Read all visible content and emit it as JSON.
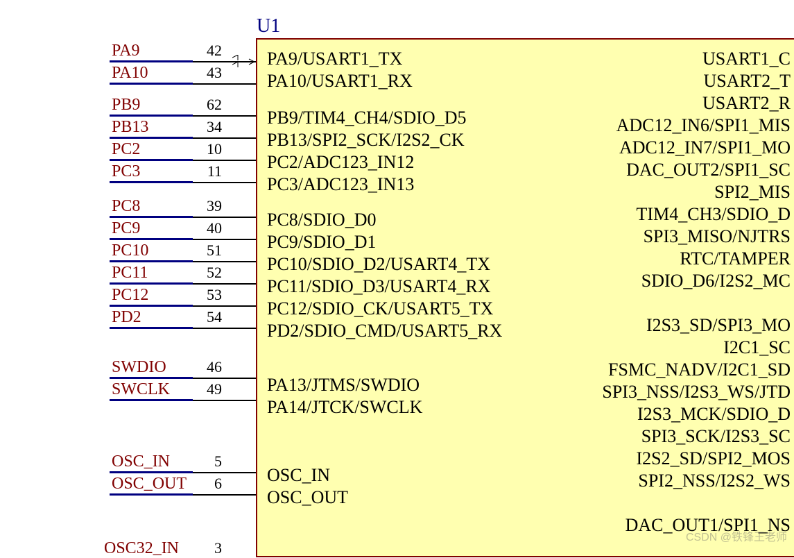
{
  "designator": "U1",
  "left_pins": [
    {
      "net": "PA9",
      "num": "42",
      "func": "PA9/USART1_TX"
    },
    {
      "net": "PA10",
      "num": "43",
      "func": "PA10/USART1_RX"
    },
    null,
    {
      "net": "PB9",
      "num": "62",
      "func": "PB9/TIM4_CH4/SDIO_D5"
    },
    {
      "net": "PB13",
      "num": "34",
      "func": "PB13/SPI2_SCK/I2S2_CK"
    },
    {
      "net": "PC2",
      "num": "10",
      "func": "PC2/ADC123_IN12"
    },
    {
      "net": "PC3",
      "num": "11",
      "func": "PC3/ADC123_IN13"
    },
    null,
    {
      "net": "PC8",
      "num": "39",
      "func": "PC8/SDIO_D0"
    },
    {
      "net": "PC9",
      "num": "40",
      "func": "PC9/SDIO_D1"
    },
    {
      "net": "PC10",
      "num": "51",
      "func": "PC10/SDIO_D2/USART4_TX"
    },
    {
      "net": "PC11",
      "num": "52",
      "func": "PC11/SDIO_D3/USART4_RX"
    },
    {
      "net": "PC12",
      "num": "53",
      "func": "PC12/SDIO_CK/USART5_TX"
    },
    {
      "net": "PD2",
      "num": "54",
      "func": "PD2/SDIO_CMD/USART5_RX"
    },
    null,
    {
      "net": "SWDIO",
      "num": "46",
      "func": "PA13/JTMS/SWDIO"
    },
    {
      "net": "SWCLK",
      "num": "49",
      "func": "PA14/JTCK/SWCLK"
    },
    null,
    null,
    {
      "net": "OSC_IN",
      "num": "5",
      "func": "OSC_IN"
    },
    {
      "net": "OSC_OUT",
      "num": "6",
      "func": "OSC_OUT"
    },
    null,
    null,
    {
      "net": "OSC32_IN",
      "num": "3",
      "func": ""
    }
  ],
  "right_funcs": [
    "USART1_C",
    "USART2_T",
    "USART2_R",
    "ADC12_IN6/SPI1_MIS",
    "ADC12_IN7/SPI1_MO",
    "DAC_OUT2/SPI1_SC",
    "SPI2_MIS",
    "TIM4_CH3/SDIO_D",
    "SPI3_MISO/NJTRS",
    "RTC/TAMPER",
    "SDIO_D6/I2S2_MC",
    "",
    "I2S3_SD/SPI3_MO",
    "I2C1_SC",
    "FSMC_NADV/I2C1_SD",
    "SPI3_NSS/I2S3_WS/JTD",
    "I2S3_MCK/SDIO_D",
    "SPI3_SCK/I2S3_SC",
    "I2S2_SD/SPI2_MOS",
    "SPI2_NSS/I2S2_WS",
    "",
    "DAC_OUT1/SPI1_NS"
  ],
  "watermark": "CSDN @铁锋王老师"
}
